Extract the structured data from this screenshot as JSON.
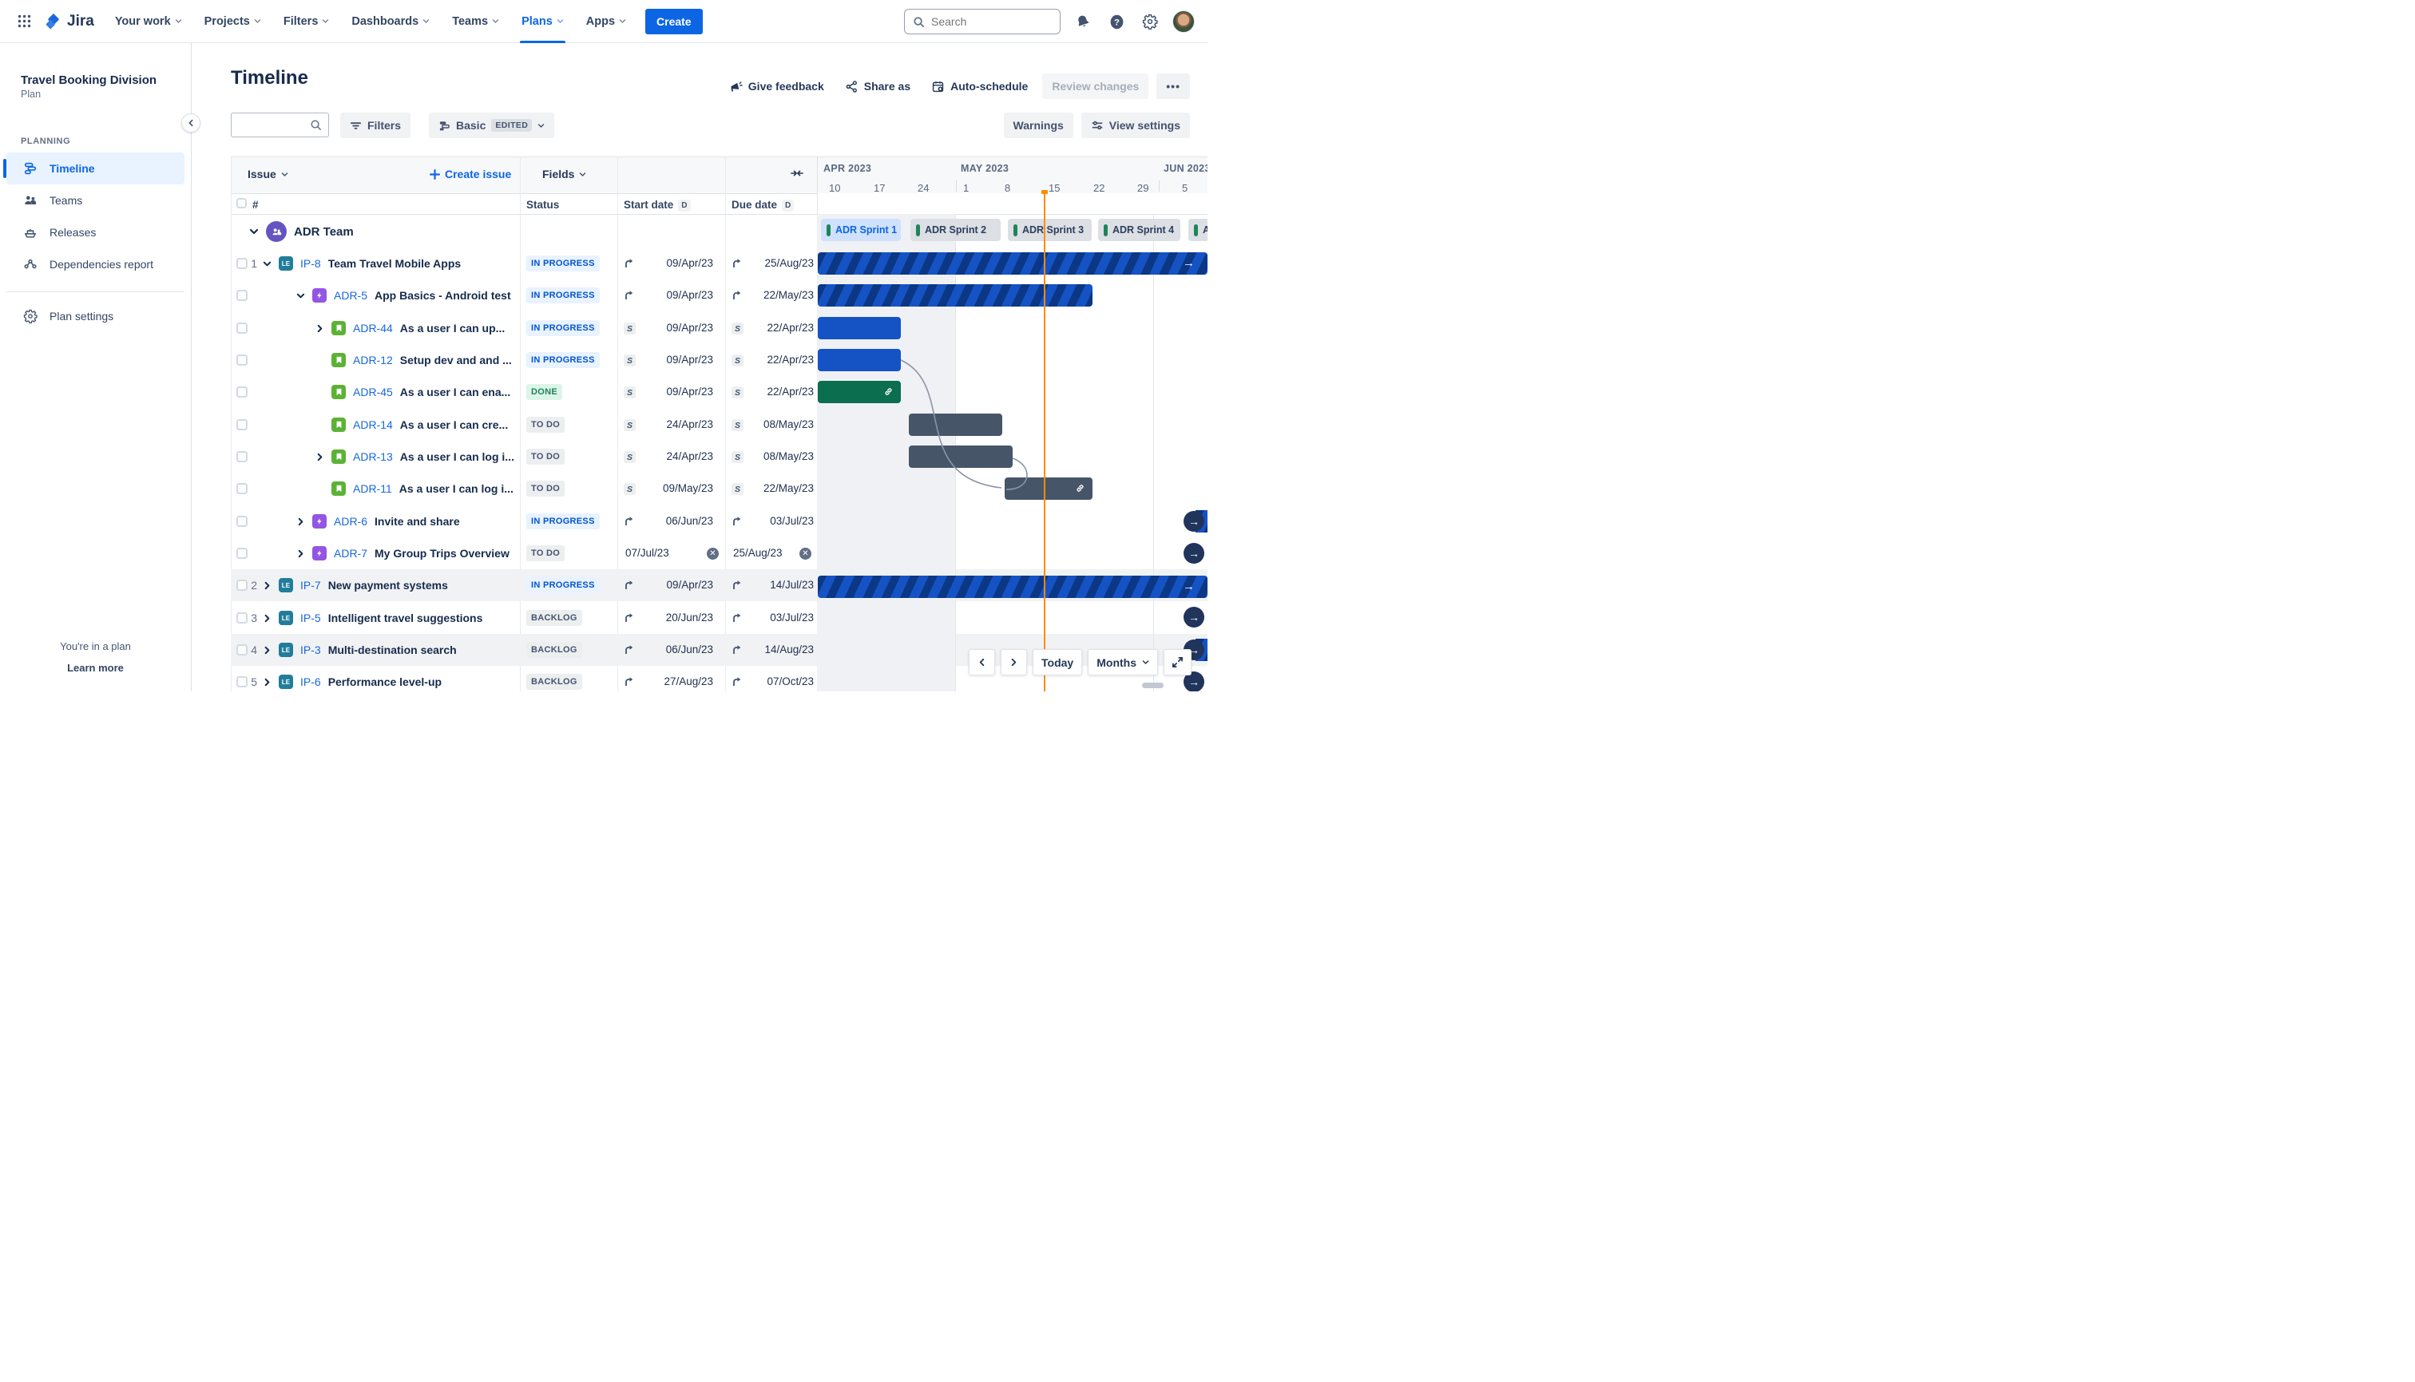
{
  "nav": {
    "brand": "Jira",
    "menus": [
      "Your work",
      "Projects",
      "Filters",
      "Dashboards",
      "Teams",
      "Plans",
      "Apps"
    ],
    "active_menu": "Plans",
    "create_label": "Create",
    "search_placeholder": "Search"
  },
  "sidebar": {
    "title": "Travel Booking Division",
    "subtitle": "Plan",
    "section": "PLANNING",
    "items": [
      {
        "label": "Timeline"
      },
      {
        "label": "Teams"
      },
      {
        "label": "Releases"
      },
      {
        "label": "Dependencies report"
      }
    ],
    "settings_label": "Plan settings",
    "footer_line": "You're in a plan",
    "footer_link": "Learn more"
  },
  "header": {
    "title": "Timeline",
    "give_feedback": "Give feedback",
    "share_as": "Share as",
    "auto_schedule": "Auto-schedule",
    "review_changes": "Review changes",
    "more": "•••"
  },
  "toolbar": {
    "filters": "Filters",
    "view_name": "Basic",
    "edited_badge": "EDITED",
    "warnings": "Warnings",
    "view_settings": "View settings"
  },
  "table": {
    "issue_label": "Issue",
    "create_issue": "Create issue",
    "fields_label": "Fields",
    "hash": "#",
    "status_col": "Status",
    "start_col": "Start date",
    "due_col": "Due date",
    "d_badge": "D"
  },
  "timeline": {
    "months": [
      "APR 2023",
      "MAY 2023",
      "JUN 2023"
    ],
    "ticks": [
      "10",
      "17",
      "24",
      "1",
      "8",
      "15",
      "22",
      "29",
      "5"
    ],
    "sprints": [
      "ADR Sprint 1",
      "ADR Sprint 2",
      "ADR Sprint 3",
      "ADR Sprint 4",
      "ADR"
    ]
  },
  "team": {
    "name": "ADR Team"
  },
  "rows": [
    {
      "num": "1",
      "key": "IP-8",
      "title": "Team Travel Mobile Apps",
      "status": "IN PROGRESS",
      "start": "09/Apr/23",
      "due": "25/Aug/23"
    },
    {
      "num": "",
      "key": "ADR-5",
      "title": "App Basics - Android test",
      "status": "IN PROGRESS",
      "start": "09/Apr/23",
      "due": "22/May/23"
    },
    {
      "num": "",
      "key": "ADR-44",
      "title": "As a user I can up...",
      "status": "IN PROGRESS",
      "start": "09/Apr/23",
      "due": "22/Apr/23"
    },
    {
      "num": "",
      "key": "ADR-12",
      "title": "Setup dev and and ...",
      "status": "IN PROGRESS",
      "start": "09/Apr/23",
      "due": "22/Apr/23"
    },
    {
      "num": "",
      "key": "ADR-45",
      "title": "As a user I can ena...",
      "status": "DONE",
      "start": "09/Apr/23",
      "due": "22/Apr/23"
    },
    {
      "num": "",
      "key": "ADR-14",
      "title": "As a user I can cre...",
      "status": "TO DO",
      "start": "24/Apr/23",
      "due": "08/May/23"
    },
    {
      "num": "",
      "key": "ADR-13",
      "title": "As a user I can log i...",
      "status": "TO DO",
      "start": "24/Apr/23",
      "due": "08/May/23"
    },
    {
      "num": "",
      "key": "ADR-11",
      "title": "As a user I can log i...",
      "status": "TO DO",
      "start": "09/May/23",
      "due": "22/May/23"
    },
    {
      "num": "",
      "key": "ADR-6",
      "title": "Invite and share",
      "status": "IN PROGRESS",
      "start": "06/Jun/23",
      "due": "03/Jul/23"
    },
    {
      "num": "",
      "key": "ADR-7",
      "title": "My Group Trips Overview",
      "status": "TO DO",
      "start": "07/Jul/23",
      "due": "25/Aug/23"
    },
    {
      "num": "2",
      "key": "IP-7",
      "title": "New payment systems",
      "status": "IN PROGRESS",
      "start": "09/Apr/23",
      "due": "14/Jul/23"
    },
    {
      "num": "3",
      "key": "IP-5",
      "title": "Intelligent travel suggestions",
      "status": "BACKLOG",
      "start": "20/Jun/23",
      "due": "03/Jul/23"
    },
    {
      "num": "4",
      "key": "IP-3",
      "title": "Multi-destination search",
      "status": "BACKLOG",
      "start": "06/Jun/23",
      "due": "14/Aug/23"
    },
    {
      "num": "5",
      "key": "IP-6",
      "title": "Performance level-up",
      "status": "BACKLOG",
      "start": "27/Aug/23",
      "due": "07/Oct/23"
    }
  ],
  "controls": {
    "today": "Today",
    "zoom": "Months"
  },
  "colors": {
    "accent_blue": "#0c66e4",
    "bar_blue": "#1553c5",
    "bar_navy_stripe": "#0b3784",
    "bar_green": "#0b6e4f",
    "bar_slate": "#475569",
    "today_orange": "#ff8b00",
    "status_inprogress_text": "#0055cc",
    "status_done_text": "#1f845a",
    "epic_purple": "#9355e2",
    "story_green": "#5cb234",
    "le_teal": "#227d9b"
  }
}
